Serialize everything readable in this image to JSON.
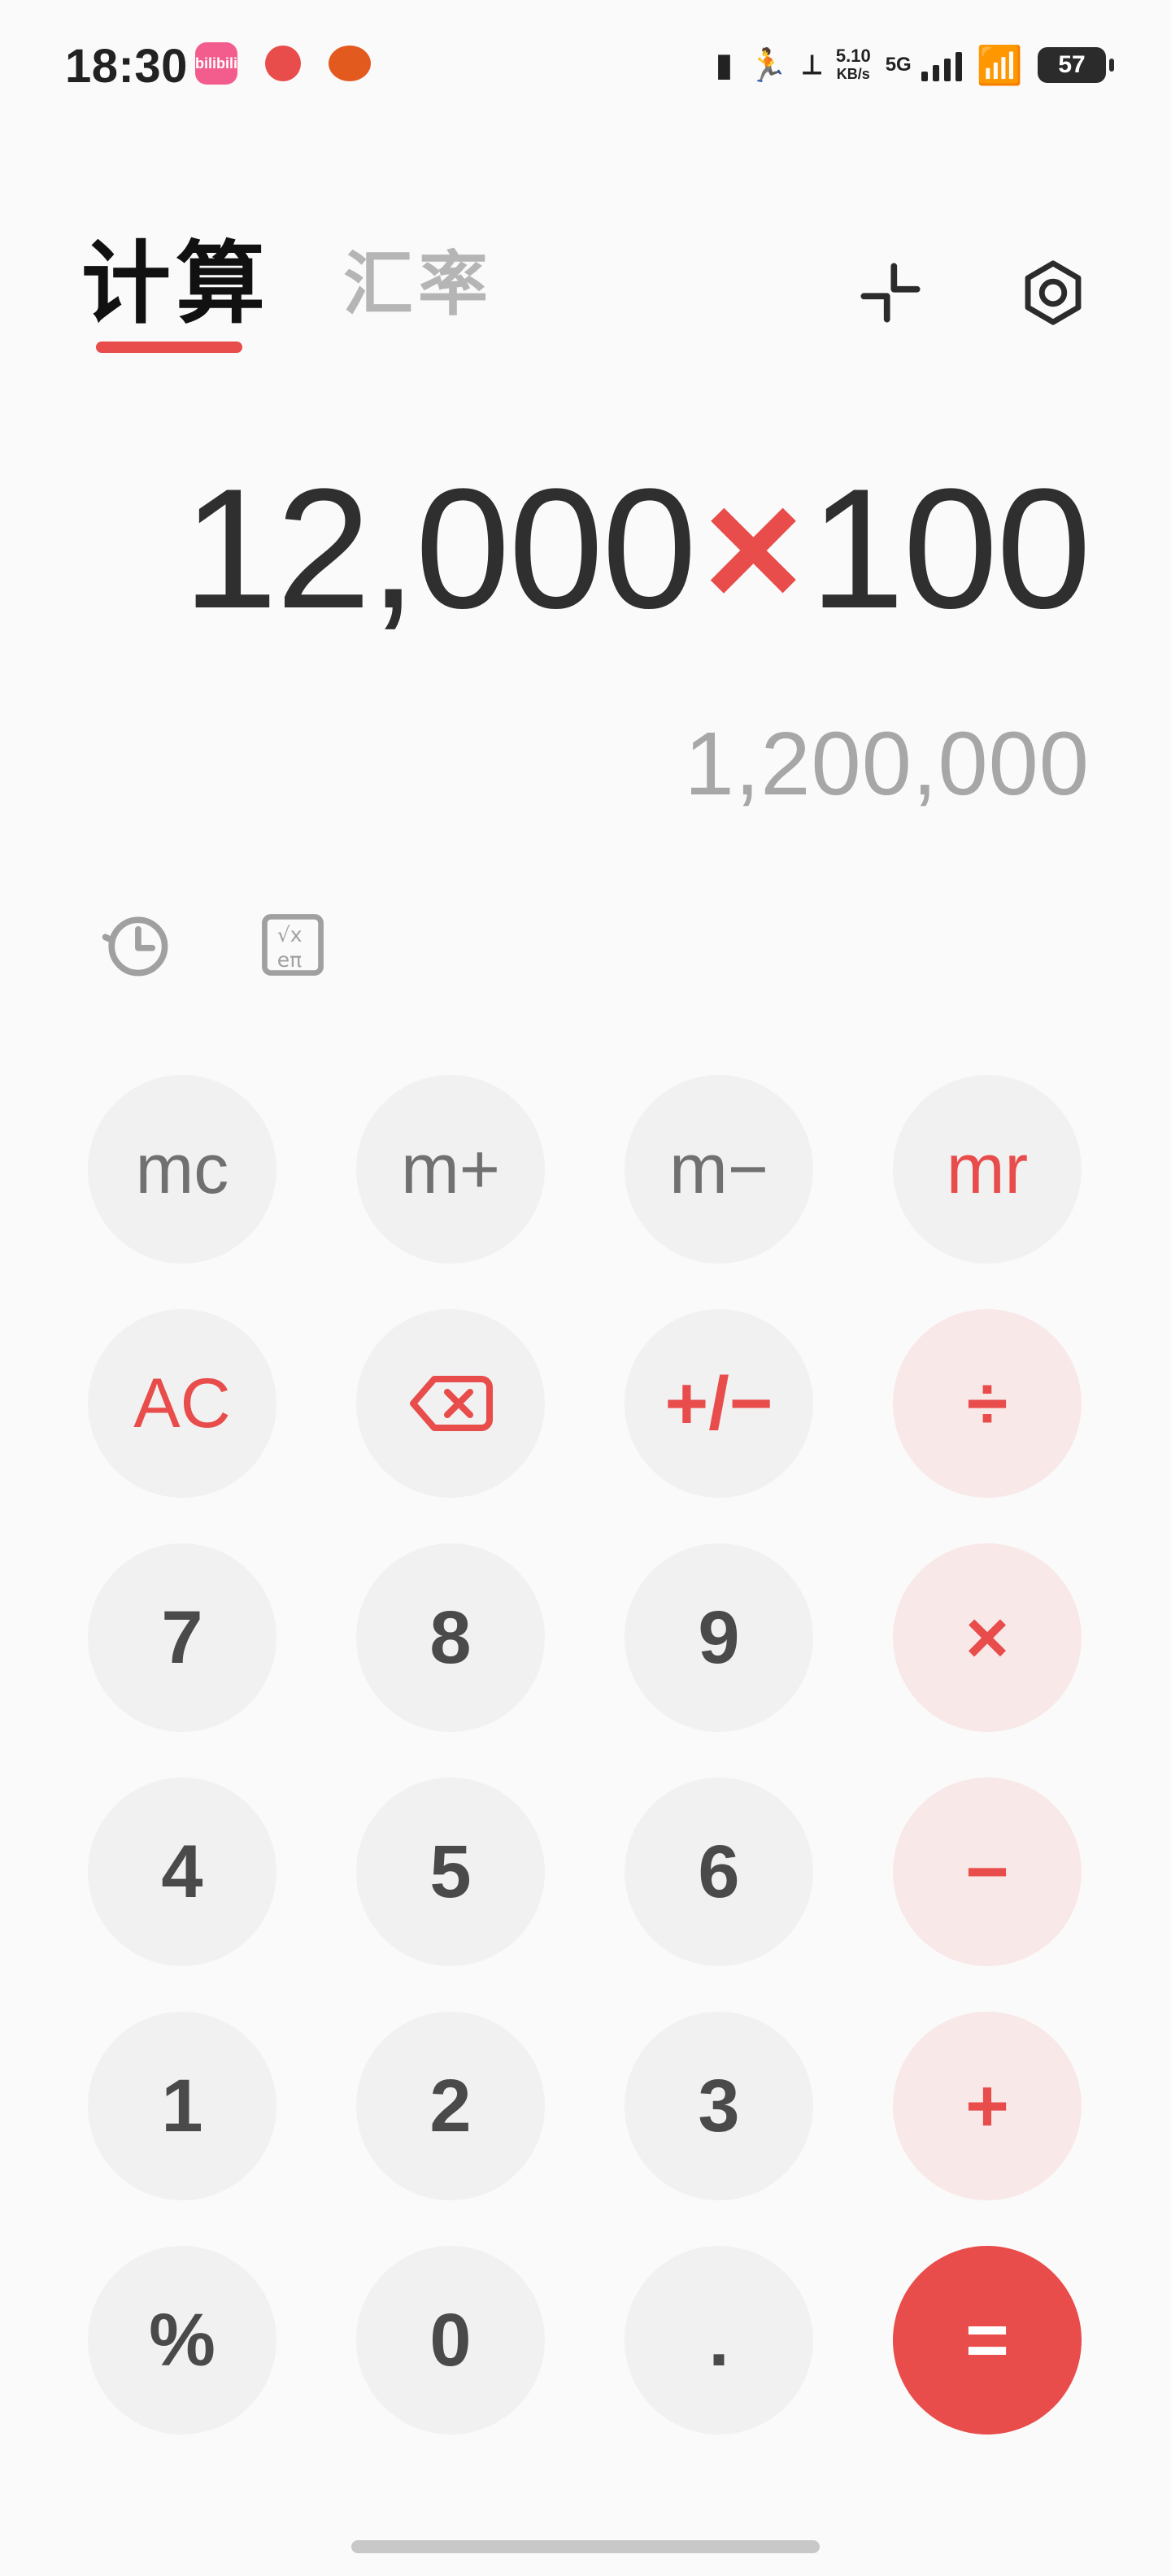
{
  "status_bar": {
    "time": "18:30",
    "notification_apps": [
      {
        "icon": "bilibili-icon",
        "label": "bilibili"
      },
      {
        "icon": "tomato-icon",
        "label": ""
      },
      {
        "icon": "cat-icon",
        "label": ""
      }
    ],
    "net_speed": "5.10",
    "net_unit": "KB/s",
    "network": "5G",
    "battery": "57"
  },
  "tabs": [
    {
      "label": "计算",
      "active": true
    },
    {
      "label": "汇率",
      "active": false
    }
  ],
  "top_actions": [
    {
      "name": "collapse-button",
      "icon": "collapse-icon"
    },
    {
      "name": "settings-button",
      "icon": "settings-icon"
    }
  ],
  "display": {
    "left": "12,000",
    "operator": "×",
    "right": "100",
    "result": "1,200,000"
  },
  "mini_tools": [
    {
      "name": "history-button",
      "icon": "history-icon"
    },
    {
      "name": "scientific-button",
      "icon": "scientific-icon"
    }
  ],
  "keypad": [
    [
      "mc",
      "m+",
      "m−",
      "mr"
    ],
    [
      "AC",
      "backspace",
      "+/−",
      "÷"
    ],
    [
      "7",
      "8",
      "9",
      "×"
    ],
    [
      "4",
      "5",
      "6",
      "−"
    ],
    [
      "1",
      "2",
      "3",
      "+"
    ],
    [
      "%",
      "0",
      ".",
      "="
    ]
  ],
  "colors": {
    "accent": "#e84c4b",
    "operator_bg": "#f9e8e8",
    "key_bg": "#f1f1f1"
  }
}
